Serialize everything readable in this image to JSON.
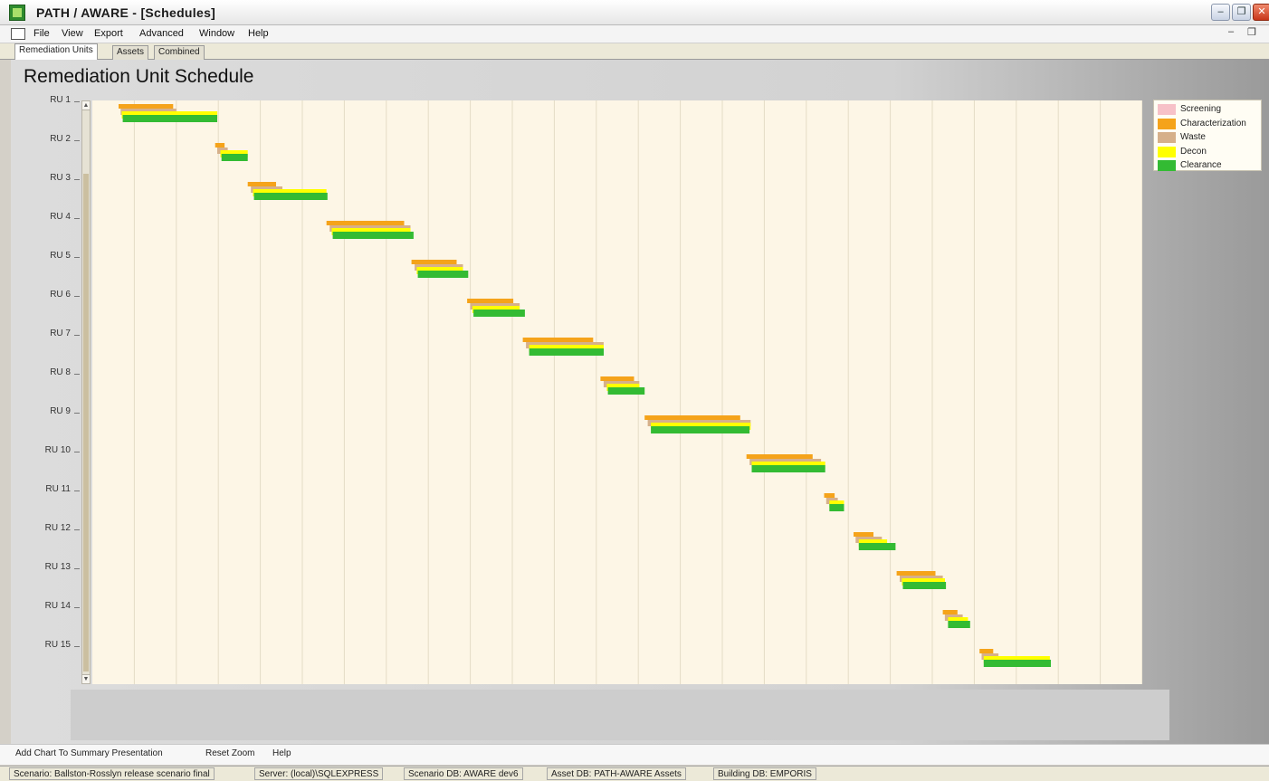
{
  "window": {
    "title": "PATH / AWARE - [Schedules]",
    "min_glyph": "–",
    "max_glyph": "❐",
    "close_glyph": "✕"
  },
  "menu": {
    "items": [
      "File",
      "View",
      "Export",
      "Advanced",
      "Window",
      "Help"
    ],
    "child_min_glyph": "–",
    "child_restore_glyph": "❐"
  },
  "tabs": [
    "Remediation Units",
    "Assets",
    "Combined"
  ],
  "active_tab": "Remediation Units",
  "chart_title": "Remediation Unit Schedule",
  "scroll": {
    "up_glyph": "▲",
    "down_glyph": "▼"
  },
  "chart_data": {
    "type": "bar",
    "orientation": "horizontal",
    "title": "Remediation Unit Schedule",
    "xlabel": "",
    "ylabel": "",
    "x_tick_labels_visible": false,
    "xlim": [
      0,
      100
    ],
    "grid": {
      "vertical": true,
      "horizontal": false
    },
    "legend_position": "top-right",
    "categories": [
      "RU 1",
      "RU 2",
      "RU 3",
      "RU 4",
      "RU 5",
      "RU 6",
      "RU 7",
      "RU 8",
      "RU 9",
      "RU 10",
      "RU 11",
      "RU 12",
      "RU 13",
      "RU 14",
      "RU 15"
    ],
    "series": [
      {
        "name": "Screening",
        "color": "#f7c1c8",
        "ranges": [
          [
            2.5,
            7.7
          ],
          [
            11.7,
            12.6
          ],
          [
            14.8,
            17.5
          ],
          [
            22.3,
            29.7
          ],
          [
            30.4,
            34.7
          ],
          [
            35.7,
            40.1
          ],
          [
            41.0,
            47.7
          ],
          [
            48.4,
            51.6
          ],
          [
            52.6,
            61.7
          ],
          [
            62.3,
            68.6
          ],
          [
            69.7,
            70.7
          ],
          [
            72.5,
            74.4
          ],
          [
            76.6,
            80.3
          ],
          [
            81.0,
            82.4
          ],
          [
            84.5,
            85.8
          ]
        ]
      },
      {
        "name": "Characterization",
        "color": "#f5a31a",
        "ranges": [
          [
            2.5,
            7.7
          ],
          [
            11.7,
            12.6
          ],
          [
            14.8,
            17.5
          ],
          [
            22.3,
            29.7
          ],
          [
            30.4,
            34.7
          ],
          [
            35.7,
            40.1
          ],
          [
            41.0,
            47.7
          ],
          [
            48.4,
            51.6
          ],
          [
            52.6,
            61.7
          ],
          [
            62.3,
            68.6
          ],
          [
            69.7,
            70.7
          ],
          [
            72.5,
            74.4
          ],
          [
            76.6,
            80.3
          ],
          [
            81.0,
            82.4
          ],
          [
            84.5,
            85.8
          ]
        ]
      },
      {
        "name": "Waste",
        "color": "#d6b08a",
        "ranges": [
          [
            2.7,
            8.0
          ],
          [
            11.9,
            12.9
          ],
          [
            15.1,
            18.1
          ],
          [
            22.6,
            30.3
          ],
          [
            30.7,
            35.3
          ],
          [
            36.0,
            40.7
          ],
          [
            41.3,
            48.7
          ],
          [
            48.7,
            52.1
          ],
          [
            52.9,
            62.7
          ],
          [
            62.6,
            69.4
          ],
          [
            69.9,
            71.0
          ],
          [
            72.7,
            75.2
          ],
          [
            76.9,
            81.0
          ],
          [
            81.2,
            82.9
          ],
          [
            84.7,
            86.3
          ]
        ]
      },
      {
        "name": "Decon",
        "color": "#ffff00",
        "ranges": [
          [
            2.8,
            11.9
          ],
          [
            12.2,
            14.8
          ],
          [
            15.3,
            22.3
          ],
          [
            22.8,
            30.3
          ],
          [
            30.9,
            35.3
          ],
          [
            36.2,
            40.7
          ],
          [
            41.6,
            48.7
          ],
          [
            49.0,
            52.1
          ],
          [
            53.2,
            62.7
          ],
          [
            62.8,
            69.8
          ],
          [
            70.2,
            71.6
          ],
          [
            73.0,
            75.7
          ],
          [
            77.1,
            81.2
          ],
          [
            81.5,
            83.4
          ],
          [
            84.9,
            91.2
          ]
        ]
      },
      {
        "name": "Clearance",
        "color": "#33bb33",
        "ranges": [
          [
            2.9,
            11.9
          ],
          [
            12.3,
            14.8
          ],
          [
            15.4,
            22.4
          ],
          [
            22.9,
            30.6
          ],
          [
            31.0,
            35.8
          ],
          [
            36.3,
            41.2
          ],
          [
            41.6,
            48.7
          ],
          [
            49.1,
            52.6
          ],
          [
            53.2,
            62.6
          ],
          [
            62.8,
            69.8
          ],
          [
            70.2,
            71.6
          ],
          [
            73.0,
            76.5
          ],
          [
            77.2,
            81.3
          ],
          [
            81.5,
            83.6
          ],
          [
            84.9,
            91.3
          ]
        ]
      }
    ]
  },
  "bottom_toolbar": {
    "add_chart": "Add Chart To Summary Presentation",
    "reset_zoom": "Reset Zoom",
    "help": "Help"
  },
  "status": {
    "scenario": "Scenario: Ballston-Rosslyn release scenario final",
    "server": "Server: (local)\\SQLEXPRESS",
    "scenario_db": "Scenario DB: AWARE dev6",
    "asset_db": "Asset DB: PATH-AWARE Assets",
    "building_db": "Building DB: EMPORIS"
  }
}
